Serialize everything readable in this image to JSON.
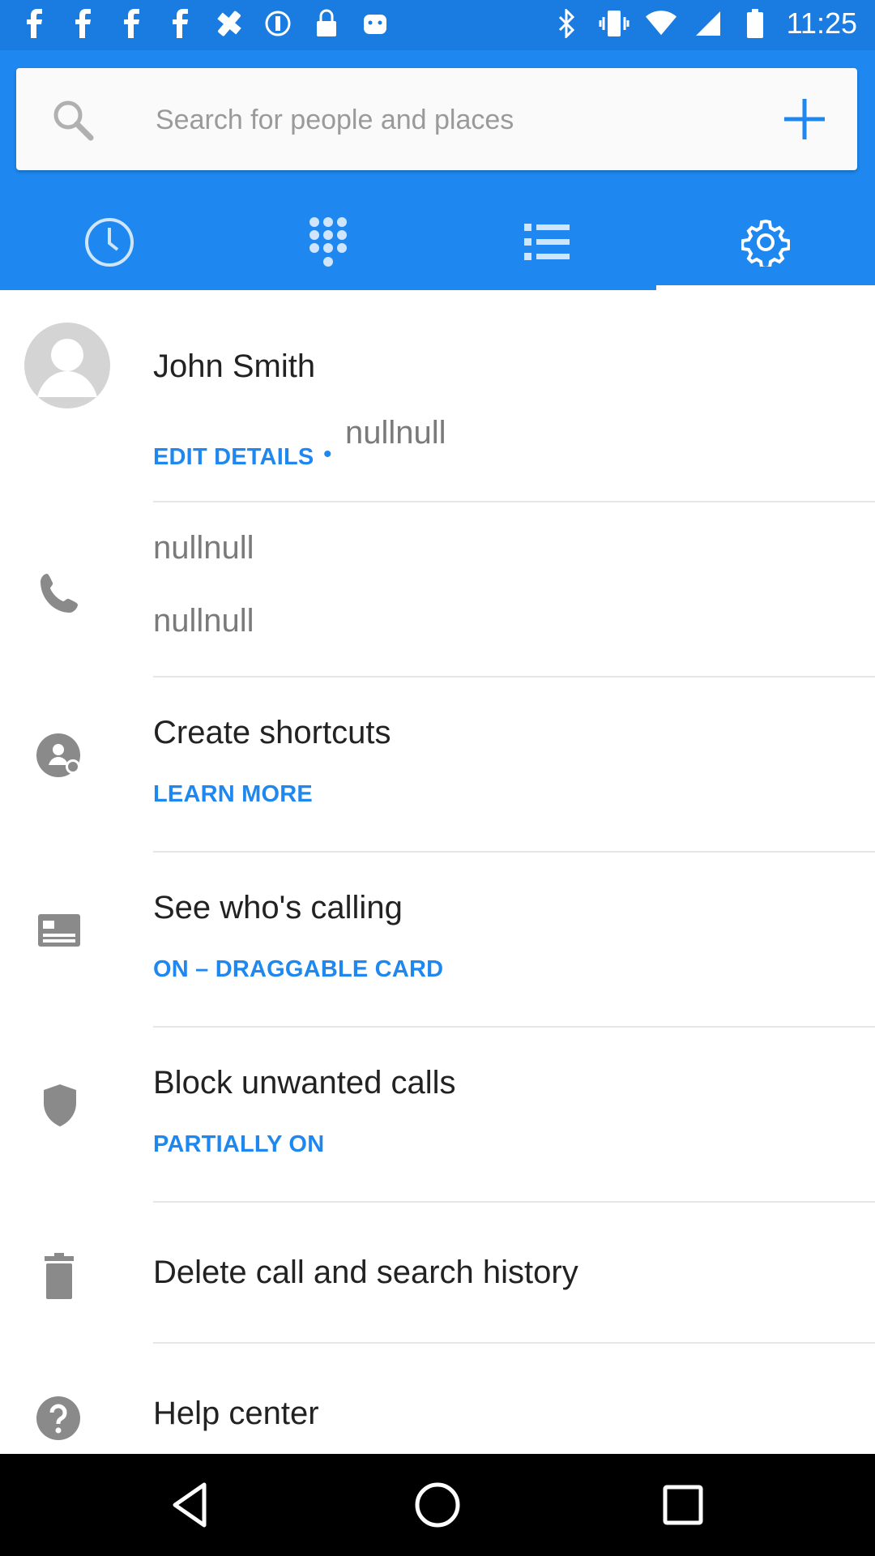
{
  "status_bar": {
    "time": "11:25",
    "left_icons": [
      "facebook-icon",
      "facebook-icon",
      "facebook-icon",
      "facebook-icon",
      "fake-gps-icon",
      "settings-icon",
      "lock-icon",
      "android-icon"
    ],
    "right_icons": [
      "bluetooth-icon",
      "vibrate-icon",
      "wifi-icon",
      "signal-icon",
      "battery-icon"
    ]
  },
  "search": {
    "placeholder": "Search for people and places"
  },
  "tabs": [
    {
      "name": "recent",
      "icon": "clock-icon"
    },
    {
      "name": "dialpad",
      "icon": "dialpad-icon"
    },
    {
      "name": "contacts",
      "icon": "list-icon"
    },
    {
      "name": "settings",
      "icon": "gear-icon",
      "active": true
    }
  ],
  "profile": {
    "name": "John Smith",
    "edit_label": "EDIT DETAILS",
    "bullet": "•",
    "value": "nullnull"
  },
  "phone": {
    "line1": "nullnull",
    "line2": "nullnull"
  },
  "items": [
    {
      "title": "Create shortcuts",
      "sub": "LEARN MORE",
      "icon": "shortcut-icon"
    },
    {
      "title": "See who's calling",
      "sub": "ON – DRAGGABLE CARD",
      "icon": "card-icon"
    },
    {
      "title": "Block unwanted calls",
      "sub": "PARTIALLY ON",
      "icon": "shield-icon"
    },
    {
      "title": "Delete call and search history",
      "sub": "",
      "icon": "trash-icon"
    },
    {
      "title": "Help center",
      "sub": "",
      "icon": "help-icon"
    }
  ],
  "colors": {
    "accent": "#1e88f0",
    "status_bar": "#1a7be0",
    "icon_gray": "#8a8a8a"
  }
}
